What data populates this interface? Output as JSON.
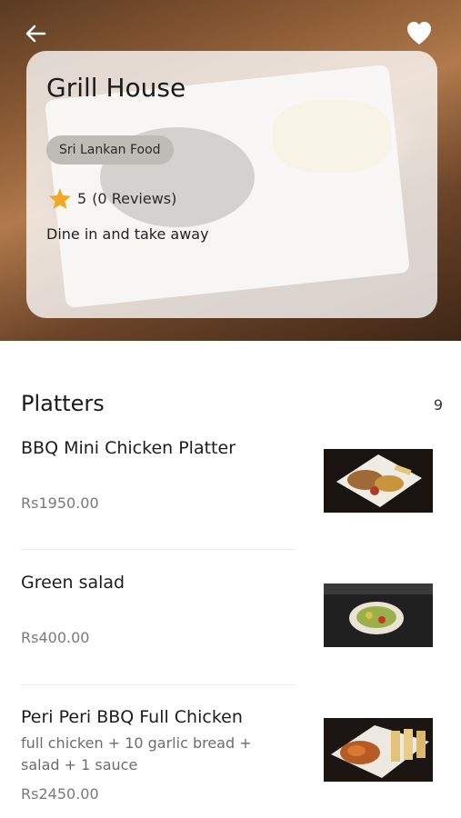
{
  "header": {
    "back_icon": "arrow-left-icon",
    "favorite_icon": "heart-icon"
  },
  "restaurant": {
    "name": "Grill House",
    "category": "Sri Lankan Food",
    "rating_icon": "star-icon",
    "rating": "5",
    "reviews": "(0 Reviews)",
    "service": "Dine in and take away"
  },
  "menu": {
    "section_title": "Platters",
    "item_count": "9",
    "items": [
      {
        "name": "BBQ Mini Chicken Platter",
        "description": "",
        "price": "Rs1950.00"
      },
      {
        "name": "Green salad",
        "description": "",
        "price": "Rs400.00"
      },
      {
        "name": "Peri Peri BBQ Full Chicken",
        "description": "full chicken + 10 garlic bread + salad + 1 sauce",
        "price": "Rs2450.00"
      }
    ]
  },
  "colors": {
    "star": "#f5a623",
    "tag_bg": "#bfbcb8"
  }
}
